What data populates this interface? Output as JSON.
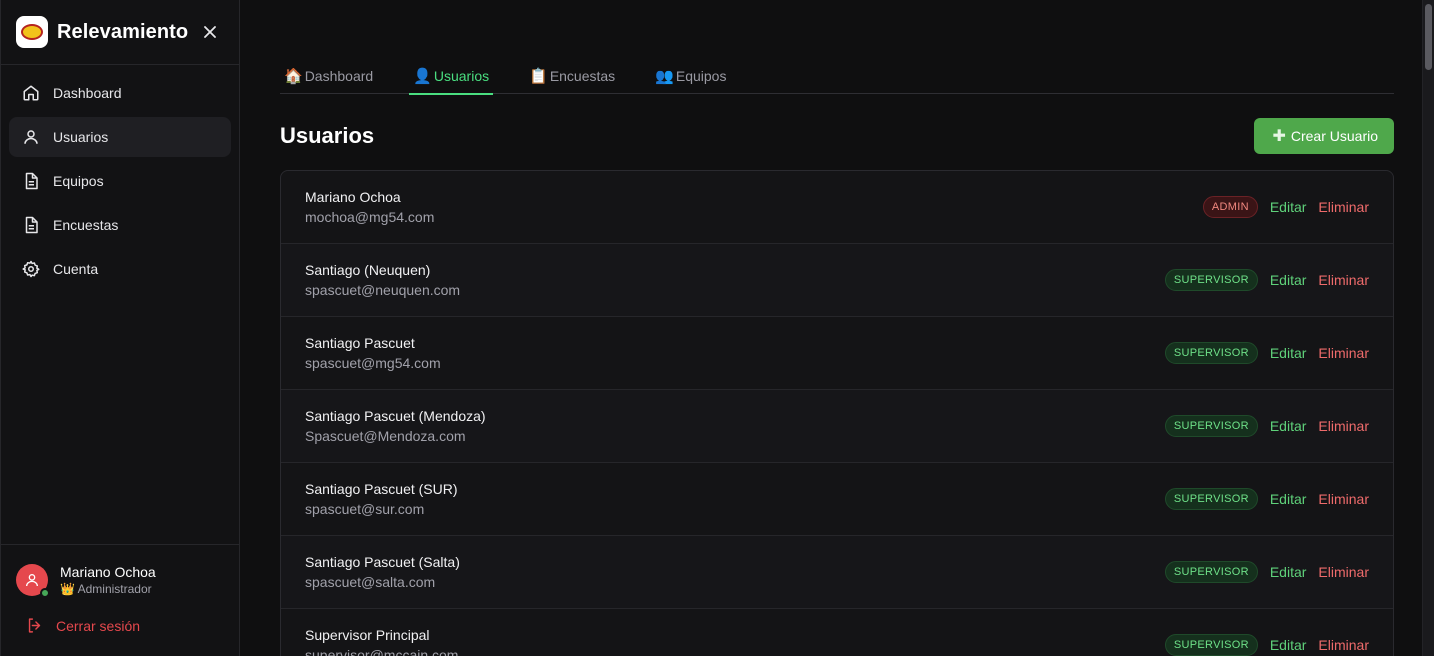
{
  "brand": {
    "title": "Relevamiento",
    "logo_text": "McCain"
  },
  "sidebar": {
    "items": [
      {
        "label": "Dashboard",
        "icon": "home-icon"
      },
      {
        "label": "Usuarios",
        "icon": "user-icon"
      },
      {
        "label": "Equipos",
        "icon": "document-icon"
      },
      {
        "label": "Encuestas",
        "icon": "document-icon"
      },
      {
        "label": "Cuenta",
        "icon": "gear-icon"
      }
    ],
    "active_index": 1,
    "user": {
      "name": "Mariano Ochoa",
      "role": "👑 Administrador"
    },
    "logout_label": "Cerrar sesión"
  },
  "tabs": [
    {
      "emoji": "🏠",
      "label": "Dashboard"
    },
    {
      "emoji": "👤",
      "label": "Usuarios"
    },
    {
      "emoji": "📋",
      "label": "Encuestas"
    },
    {
      "emoji": "👥",
      "label": "Equipos"
    }
  ],
  "page": {
    "title": "Usuarios",
    "create_button": "Crear Usuario",
    "create_icon": "✚"
  },
  "actions": {
    "edit": "Editar",
    "delete": "Eliminar"
  },
  "users": [
    {
      "name": "Mariano Ochoa",
      "email": "mochoa@mg54.com",
      "role": "ADMIN"
    },
    {
      "name": "Santiago (Neuquen)",
      "email": "spascuet@neuquen.com",
      "role": "SUPERVISOR"
    },
    {
      "name": "Santiago Pascuet",
      "email": "spascuet@mg54.com",
      "role": "SUPERVISOR"
    },
    {
      "name": "Santiago Pascuet (Mendoza)",
      "email": "Spascuet@Mendoza.com",
      "role": "SUPERVISOR"
    },
    {
      "name": "Santiago Pascuet (SUR)",
      "email": "spascuet@sur.com",
      "role": "SUPERVISOR"
    },
    {
      "name": "Santiago Pascuet (Salta)",
      "email": "spascuet@salta.com",
      "role": "SUPERVISOR"
    },
    {
      "name": "Supervisor Principal",
      "email": "supervisor@mccain.com",
      "role": "SUPERVISOR"
    }
  ],
  "colors": {
    "accent": "#4ade80",
    "button": "#4fa84b",
    "danger": "#ef6b6b",
    "admin_badge": "#f1877f",
    "supervisor_badge": "#6ee088"
  }
}
